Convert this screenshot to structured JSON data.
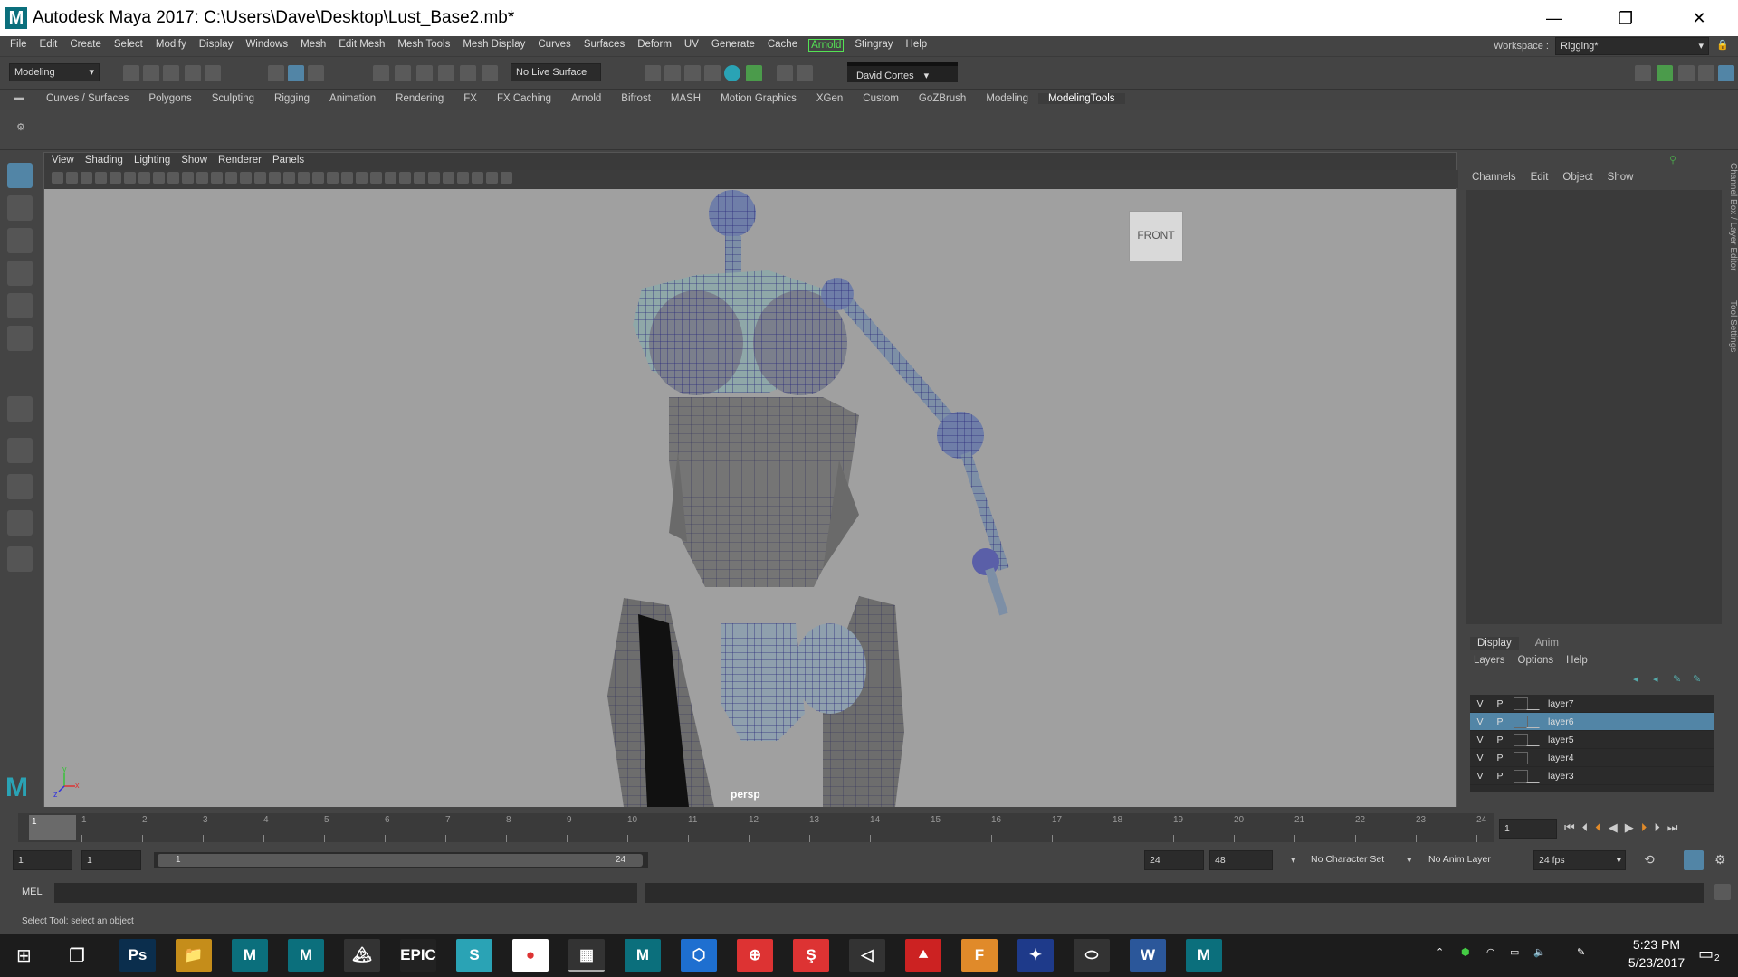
{
  "titlebar": {
    "logo": "M",
    "title": "Autodesk Maya 2017: C:\\Users\\Dave\\Desktop\\Lust_Base2.mb*",
    "minimize": "—",
    "restore": "❐",
    "close": "✕"
  },
  "menubar": {
    "items": [
      "File",
      "Edit",
      "Create",
      "Select",
      "Modify",
      "Display",
      "Windows",
      "Mesh",
      "Edit Mesh",
      "Mesh Tools",
      "Mesh Display",
      "Curves",
      "Surfaces",
      "Deform",
      "UV",
      "Generate",
      "Cache",
      "Arnold",
      "Stingray",
      "Help"
    ],
    "workspace_label": "Workspace :",
    "workspace_value": "Rigging*"
  },
  "statusline": {
    "menuset": "Modeling",
    "live_surface": "No Live Surface",
    "user": "David Cortes"
  },
  "shelf": {
    "tabs": [
      "Curves / Surfaces",
      "Polygons",
      "Sculpting",
      "Rigging",
      "Animation",
      "Rendering",
      "FX",
      "FX Caching",
      "Arnold",
      "Bifrost",
      "MASH",
      "Motion Graphics",
      "XGen",
      "Custom",
      "GoZBrush",
      "Modeling",
      "ModelingTools"
    ],
    "active_tab": "ModelingTools"
  },
  "viewport": {
    "menu": [
      "View",
      "Shading",
      "Lighting",
      "Show",
      "Renderer",
      "Panels"
    ],
    "camera_label": "persp",
    "viewcube_label": "FRONT",
    "axis_x": "x",
    "axis_y": "y",
    "axis_z": "z",
    "background": "#a0a0a0"
  },
  "channel_box": {
    "menu": [
      "Channels",
      "Edit",
      "Object",
      "Show"
    ],
    "side_tab_1": "Channel Box / Layer Editor",
    "side_tab_2": "Tool Settings"
  },
  "layer_editor": {
    "tabs": [
      "Display",
      "Anim"
    ],
    "active_tab": "Display",
    "menu": [
      "Layers",
      "Options",
      "Help"
    ],
    "layers": [
      {
        "v": "V",
        "p": "P",
        "name": "layer7",
        "selected": false
      },
      {
        "v": "V",
        "p": "P",
        "name": "layer6",
        "selected": true
      },
      {
        "v": "V",
        "p": "P",
        "name": "layer5",
        "selected": false
      },
      {
        "v": "V",
        "p": "P",
        "name": "layer4",
        "selected": false
      },
      {
        "v": "V",
        "p": "P",
        "name": "layer3",
        "selected": false
      }
    ]
  },
  "timeline": {
    "current_frame_label": "1",
    "ticks": [
      "1",
      "2",
      "3",
      "4",
      "5",
      "6",
      "7",
      "8",
      "9",
      "10",
      "11",
      "12",
      "13",
      "14",
      "15",
      "16",
      "17",
      "18",
      "19",
      "20",
      "21",
      "22",
      "23",
      "24"
    ],
    "current_frame_field": "1"
  },
  "range": {
    "start_field": "1",
    "playback_start": "1",
    "slider_start": "1",
    "slider_end": "24",
    "playback_end": "24",
    "end_field": "48",
    "character_set": "No Character Set",
    "anim_layer": "No Anim Layer",
    "fps": "24 fps"
  },
  "cmdline": {
    "label": "MEL"
  },
  "helpline": {
    "text": "Select Tool: select an object"
  },
  "taskbar": {
    "apps": [
      "Ps",
      "📁",
      "M",
      "M",
      "🏔",
      "EPIC",
      "S",
      "●",
      "▦",
      "M",
      "⬡",
      "⊕",
      "Ş",
      "◁",
      "⯅",
      "F",
      "✦",
      "⬭",
      "W",
      "M"
    ],
    "time": "5:23 PM",
    "date": "5/23/2017",
    "notifications": "2"
  },
  "colors": {
    "accent": "#5285a6",
    "arnold": "#54e354",
    "mesh_wire": "#2a2a7a"
  }
}
